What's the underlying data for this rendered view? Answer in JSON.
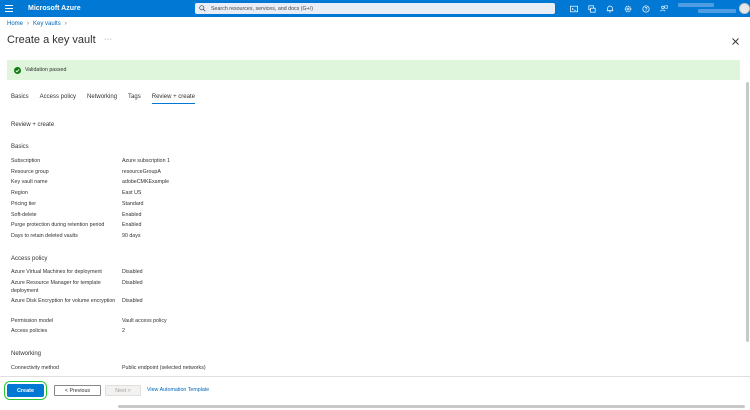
{
  "topbar": {
    "brand": "Microsoft Azure",
    "search_placeholder": "Search resources, services, and docs (G+/)"
  },
  "breadcrumb": {
    "home": "Home",
    "key_vaults": "Key vaults"
  },
  "page": {
    "title": "Create a key vault",
    "more": "···"
  },
  "banner": {
    "text": "Validation passed",
    "color": "#dff6dd"
  },
  "tabs": [
    "Basics",
    "Access policy",
    "Networking",
    "Tags",
    "Review + create"
  ],
  "active_tab": "Review + create",
  "review": {
    "heading": "Review + create",
    "basics": {
      "heading": "Basics",
      "rows": [
        {
          "label": "Subscription",
          "value": "Azure subscription 1"
        },
        {
          "label": "Resource group",
          "value": "resourceGroupA"
        },
        {
          "label": "Key vault name",
          "value": "adobeCMKExample"
        },
        {
          "label": "Region",
          "value": "East US"
        },
        {
          "label": "Pricing tier",
          "value": "Standard"
        },
        {
          "label": "Soft-delete",
          "value": "Enabled"
        },
        {
          "label": "Purge protection during retention period",
          "value": "Enabled"
        },
        {
          "label": "Days to retain deleted vaults",
          "value": "90 days"
        }
      ]
    },
    "access_policy": {
      "heading": "Access policy",
      "rows": [
        {
          "label": "Azure Virtual Machines for deployment",
          "value": "Disabled"
        },
        {
          "label": "Azure Resource Manager for template deployment",
          "value": "Disabled"
        },
        {
          "label": "Azure Disk Encryption for volume encryption",
          "value": "Disabled"
        },
        {
          "label": "Permission model",
          "value": "Vault access policy"
        },
        {
          "label": "Access policies",
          "value": "2"
        }
      ]
    },
    "networking": {
      "heading": "Networking",
      "rows": [
        {
          "label": "Connectivity method",
          "value": "Public endpoint (selected networks)"
        }
      ]
    }
  },
  "footer": {
    "create": "Create",
    "previous": "< Previous",
    "next": "Next >",
    "automation": "View Automation Template"
  },
  "colors": {
    "accent": "#0078d4",
    "highlight_ring": "#22c833"
  },
  "icons": [
    "hamburger-icon",
    "search-icon",
    "cloud-shell-icon",
    "directory-icon",
    "bell-icon",
    "gear-icon",
    "help-icon",
    "feedback-icon",
    "check-circle-icon",
    "close-icon",
    "chevron-right-icon"
  ]
}
